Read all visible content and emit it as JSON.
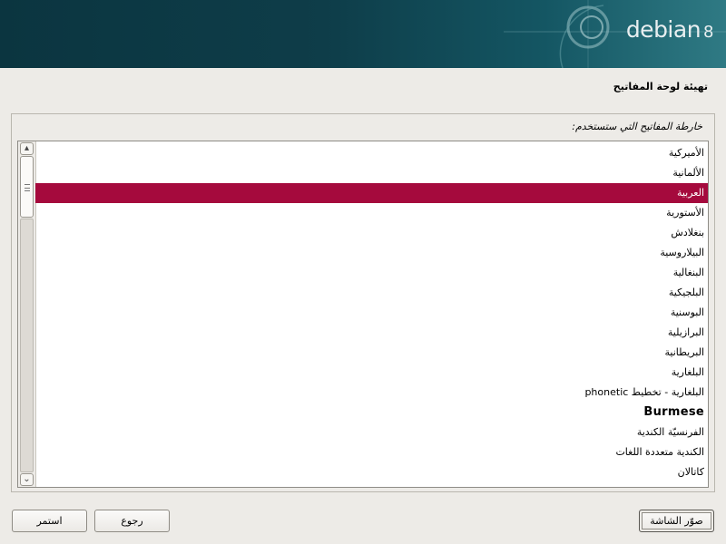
{
  "logo": {
    "name": "debian",
    "version": "8"
  },
  "page": {
    "title": "تهيئة لوحة المفاتيح"
  },
  "prompt": "خارطة المفاتيح التي ستستخدم:",
  "keymaps": [
    {
      "label": "الأميركية",
      "selected": false
    },
    {
      "label": "الألمانية",
      "selected": false
    },
    {
      "label": "العربية",
      "selected": true
    },
    {
      "label": "الأستورية",
      "selected": false
    },
    {
      "label": "بنغلادش",
      "selected": false
    },
    {
      "label": "البيلاروسية",
      "selected": false
    },
    {
      "label": "البنغالية",
      "selected": false
    },
    {
      "label": "البلجيكية",
      "selected": false
    },
    {
      "label": "البوسنية",
      "selected": false
    },
    {
      "label": "البرازيلية",
      "selected": false
    },
    {
      "label": "البريطانية",
      "selected": false
    },
    {
      "label": "البلغارية",
      "selected": false
    },
    {
      "label": "البلغارية - تخطيط phonetic",
      "selected": false
    },
    {
      "label": "Burmese",
      "selected": false
    },
    {
      "label": "الفرنسيّة الكندية",
      "selected": false
    },
    {
      "label": "الكندية متعددة اللغات",
      "selected": false
    },
    {
      "label": "كاتالان",
      "selected": false
    }
  ],
  "buttons": {
    "screenshot": "صوّر الشاشة",
    "back": "رجوع",
    "continue": "استمر"
  },
  "colors": {
    "selection": "#a50a3d",
    "banner": "#0e3d49",
    "background": "#edebe7"
  }
}
